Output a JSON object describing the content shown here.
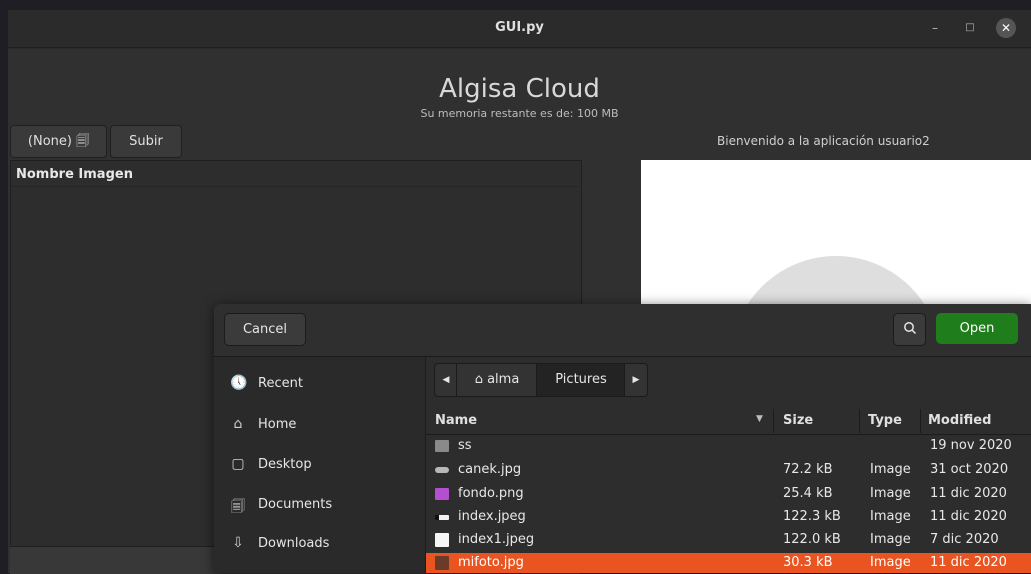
{
  "window": {
    "title": "GUI.py",
    "minimize_icon": "–",
    "maximize_icon": "□",
    "close_icon": "✕"
  },
  "app": {
    "title": "Algisa Cloud",
    "memory_text": "Su memoria restante es de: 100 MB",
    "file_chooser_label": "(None) 🗐",
    "upload_label": "Subir",
    "welcome_text": "Bienvenido a la aplicación usuario2",
    "list_header": "Nombre Imagen"
  },
  "dialog": {
    "cancel_label": "Cancel",
    "open_label": "Open",
    "search_icon": "🔍",
    "places": [
      {
        "label": "Recent",
        "icon": "🕔"
      },
      {
        "label": "Home",
        "icon": "⌂"
      },
      {
        "label": "Desktop",
        "icon": "▢"
      },
      {
        "label": "Documents",
        "icon": "🗐"
      },
      {
        "label": "Downloads",
        "icon": "⇩"
      }
    ],
    "path": {
      "back_icon": "◀",
      "home_icon": "⌂",
      "home_label": "alma",
      "current": "Pictures",
      "forward_icon": "▶"
    },
    "columns": {
      "name": "Name",
      "size": "Size",
      "type": "Type",
      "modified": "Modified",
      "sort_icon": "▼"
    },
    "files": [
      {
        "name": "ss",
        "size": "",
        "type": "",
        "modified": "19 nov 2020",
        "icon": "folder-icon"
      },
      {
        "name": "canek.jpg",
        "size": "72.2 kB",
        "type": "Image",
        "modified": "31 oct 2020",
        "icon": "image-icon"
      },
      {
        "name": "fondo.png",
        "size": "25.4 kB",
        "type": "Image",
        "modified": "11 dic 2020",
        "icon": "image-icon"
      },
      {
        "name": "index.jpeg",
        "size": "122.3 kB",
        "type": "Image",
        "modified": "11 dic 2020",
        "icon": "image-icon"
      },
      {
        "name": "index1.jpeg",
        "size": "122.0 kB",
        "type": "Image",
        "modified": "7 dic 2020",
        "icon": "image-icon"
      },
      {
        "name": "mifoto.jpg",
        "size": "30.3 kB",
        "type": "Image",
        "modified": "11 dic 2020",
        "icon": "image-icon",
        "selected": true
      }
    ]
  },
  "colors": {
    "selection": "#e95420",
    "open_button": "#1f7e1b",
    "window_bg": "#303030"
  }
}
